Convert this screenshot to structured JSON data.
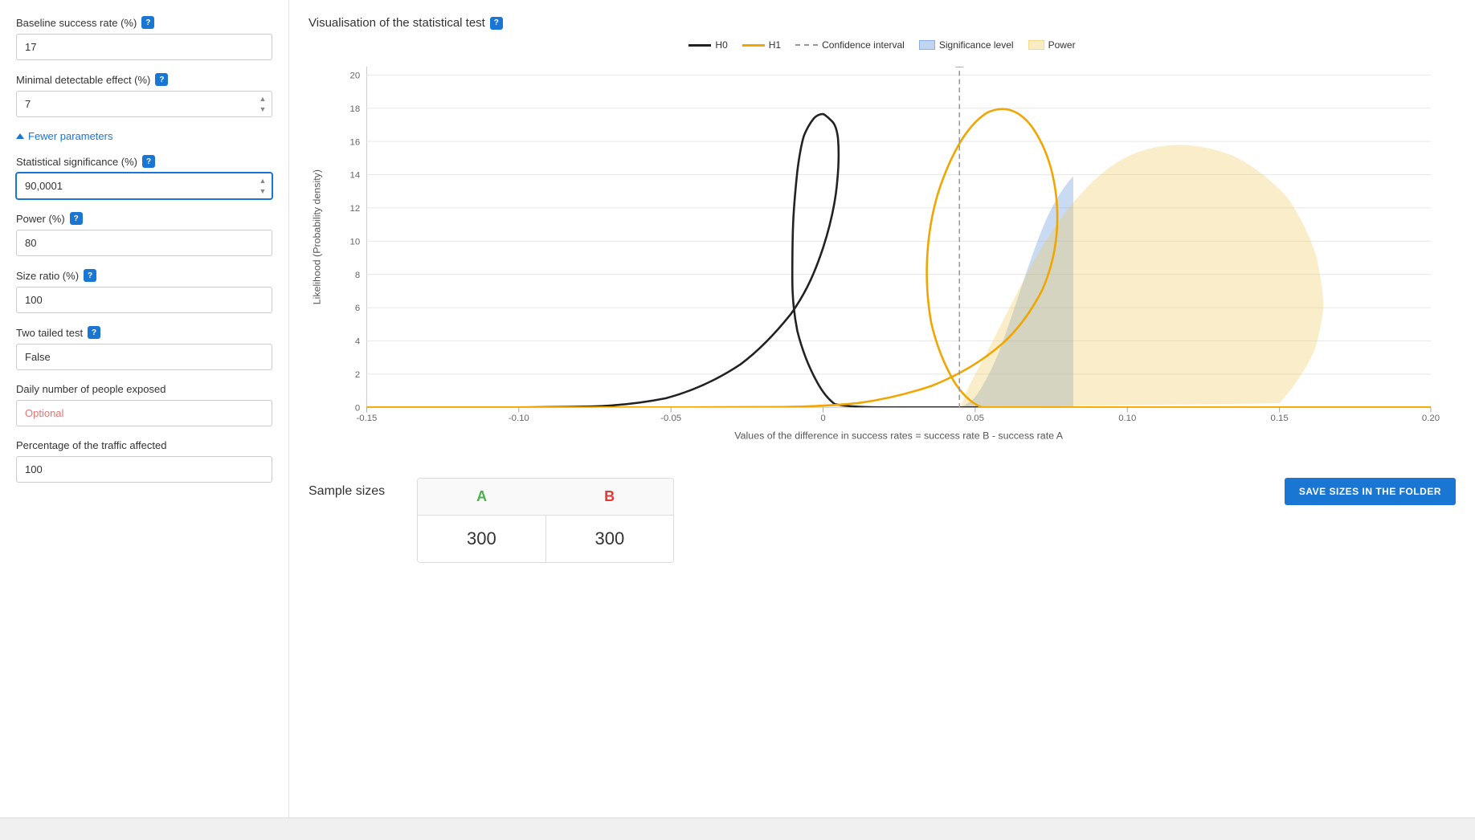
{
  "left_panel": {
    "fields": [
      {
        "id": "baseline-success-rate",
        "label": "Baseline success rate (%)",
        "help": "?",
        "value": "17",
        "type": "text",
        "active": false
      },
      {
        "id": "minimal-detectable-effect",
        "label": "Minimal detectable effect (%)",
        "help": "?",
        "value": "7",
        "type": "spinner",
        "active": false
      },
      {
        "id": "statistical-significance",
        "label": "Statistical significance (%)",
        "help": "?",
        "value": "90,0001",
        "type": "spinner",
        "active": true
      },
      {
        "id": "power",
        "label": "Power (%)",
        "help": "?",
        "value": "80",
        "type": "text",
        "active": false
      },
      {
        "id": "size-ratio",
        "label": "Size ratio (%)",
        "help": "?",
        "value": "100",
        "type": "text",
        "active": false
      },
      {
        "id": "two-tailed-test",
        "label": "Two tailed test",
        "help": "?",
        "value": "False",
        "type": "text",
        "active": false
      },
      {
        "id": "daily-exposed",
        "label": "Daily number of people exposed",
        "help": null,
        "value": "",
        "placeholder": "Optional",
        "type": "optional",
        "active": false
      },
      {
        "id": "traffic-affected",
        "label": "Percentage of the traffic affected",
        "help": null,
        "value": "100",
        "type": "text",
        "active": false
      }
    ],
    "fewer_params_label": "Fewer parameters"
  },
  "chart": {
    "title": "Visualisation of the statistical test",
    "title_help": "?",
    "legend": [
      {
        "id": "h0",
        "label": "H0",
        "type": "line-black"
      },
      {
        "id": "h1",
        "label": "H1",
        "type": "line-gold"
      },
      {
        "id": "ci",
        "label": "Confidence interval",
        "type": "dashed"
      },
      {
        "id": "sl",
        "label": "Significance level",
        "type": "rect-blue"
      },
      {
        "id": "pw",
        "label": "Power",
        "type": "rect-yellow"
      }
    ],
    "y_axis_label": "Likelihood (Probability density)",
    "x_axis_label": "Values of the difference in success rates = success rate B - success rate A",
    "y_ticks": [
      0,
      2,
      4,
      6,
      8,
      10,
      12,
      14,
      16,
      18,
      20
    ],
    "x_ticks": [
      -0.15,
      -0.1,
      -0.05,
      0,
      0.05,
      0.1,
      0.15,
      0.2
    ]
  },
  "sample_sizes": {
    "title": "Sample sizes",
    "col_a_label": "A",
    "col_b_label": "B",
    "val_a": "300",
    "val_b": "300"
  },
  "save_button_label": "SAVE SIZES IN THE FOLDER"
}
